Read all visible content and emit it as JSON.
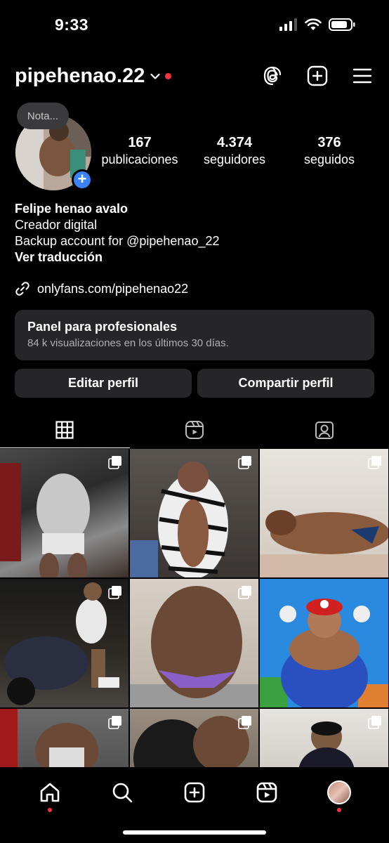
{
  "status": {
    "time": "9:33"
  },
  "header": {
    "username": "pipehenao.22"
  },
  "profile": {
    "note": "Nota...",
    "stats": [
      {
        "value": "167",
        "label": "publicaciones"
      },
      {
        "value": "4.374",
        "label": "seguidores"
      },
      {
        "value": "376",
        "label": "seguidos"
      }
    ],
    "name": "Felipe henao avalo",
    "category": "Creador digital",
    "bio": "Backup account for @pipehenao_22",
    "translate": "Ver traducción",
    "link": "onlyfans.com/pipehenao22"
  },
  "panel": {
    "title": "Panel para profesionales",
    "subtitle": "84 k visualizaciones en los últimos 30 días."
  },
  "buttons": {
    "edit": "Editar perfil",
    "share": "Compartir perfil"
  },
  "colors": {
    "accent_blue": "#3b82f6",
    "notification_red": "#ff3040",
    "surface": "#262628"
  }
}
